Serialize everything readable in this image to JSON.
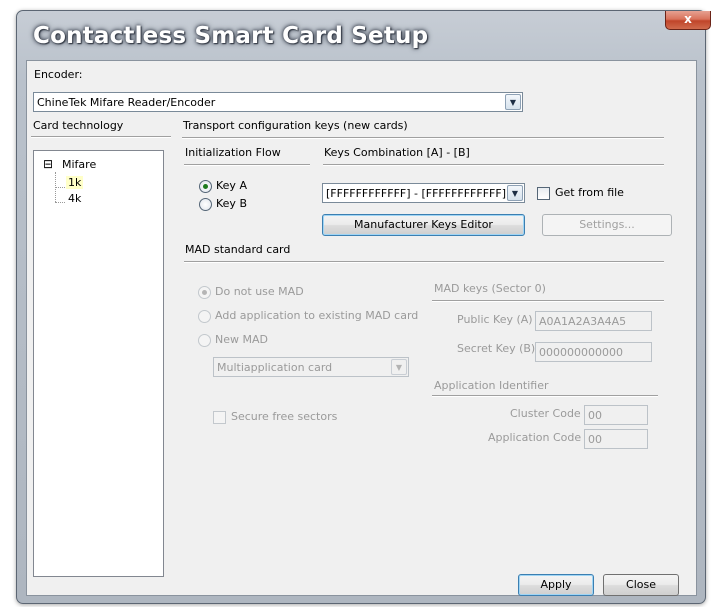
{
  "window": {
    "title": "Contactless Smart Card Setup",
    "close_glyph": "x"
  },
  "encoder": {
    "label": "Encoder:",
    "selected": "ChineTek Mifare Reader/Encoder"
  },
  "card_tech": {
    "label": "Card technology",
    "tree": {
      "root": "Mifare",
      "expander": "⊟",
      "children": [
        "1k",
        "4k"
      ],
      "selected": "1k"
    }
  },
  "transport": {
    "header": "Transport configuration keys (new cards)",
    "init_flow": {
      "label": "Initialization Flow",
      "options": [
        "Key A",
        "Key B"
      ],
      "selected": "Key A"
    },
    "keys_combination": {
      "label": "Keys Combination [A] - [B]",
      "selected": "[FFFFFFFFFFFF] - [FFFFFFFFFFFF]"
    },
    "get_from_file": {
      "label": "Get from file",
      "checked": false
    },
    "manufacturer_button": "Manufacturer Keys Editor",
    "settings_button": "Settings..."
  },
  "mad": {
    "header": "MAD standard card",
    "options": [
      "Do not use MAD",
      "Add application to existing MAD card",
      "New MAD"
    ],
    "selected": "Do not use MAD",
    "type_select": "Multiapplication card",
    "secure_free_sectors": {
      "label": "Secure free sectors",
      "checked": false
    },
    "keys": {
      "header": "MAD keys (Sector 0)",
      "public_label": "Public Key (A)",
      "public_value": "A0A1A2A3A4A5",
      "secret_label": "Secret Key (B)",
      "secret_value": "000000000000"
    },
    "app_id": {
      "header": "Application Identifier",
      "cluster_label": "Cluster Code",
      "cluster_value": "00",
      "app_label": "Application Code",
      "app_value": "00"
    }
  },
  "footer": {
    "apply": "Apply",
    "close": "Close"
  },
  "icons": {
    "dropdown": "chevron-down-icon",
    "close": "close-icon",
    "tree_collapse": "minus-box-icon"
  }
}
